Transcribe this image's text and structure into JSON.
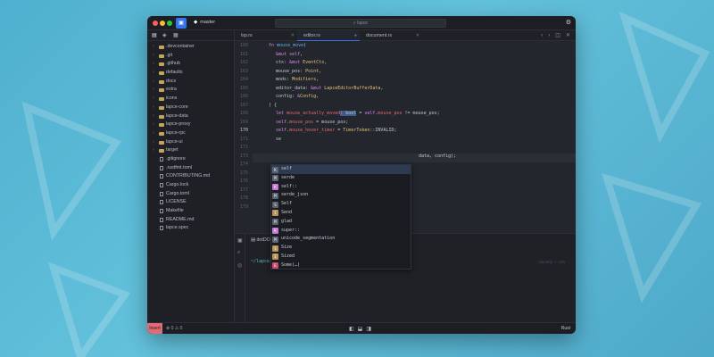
{
  "titlebar": {
    "branch": "master",
    "search_text": "lapce"
  },
  "sidebar": {
    "tree": [
      {
        "label": ".devcontainer",
        "kind": "folder"
      },
      {
        "label": ".git",
        "kind": "folder"
      },
      {
        "label": ".github",
        "kind": "folder"
      },
      {
        "label": "defaults",
        "kind": "folder"
      },
      {
        "label": "docs",
        "kind": "folder"
      },
      {
        "label": "extra",
        "kind": "folder"
      },
      {
        "label": "icons",
        "kind": "folder"
      },
      {
        "label": "lapce-core",
        "kind": "folder"
      },
      {
        "label": "lapce-data",
        "kind": "folder"
      },
      {
        "label": "lapce-proxy",
        "kind": "folder"
      },
      {
        "label": "lapce-rpc",
        "kind": "folder"
      },
      {
        "label": "lapce-ui",
        "kind": "folder"
      },
      {
        "label": "target",
        "kind": "folder"
      },
      {
        "label": ".gitignore",
        "kind": "file"
      },
      {
        "label": ".rustfmt.toml",
        "kind": "file"
      },
      {
        "label": "CONTRIBUTING.md",
        "kind": "file"
      },
      {
        "label": "Cargo.lock",
        "kind": "file"
      },
      {
        "label": "Cargo.toml",
        "kind": "file"
      },
      {
        "label": "LICENSE",
        "kind": "file"
      },
      {
        "label": "Makefile",
        "kind": "file"
      },
      {
        "label": "README.md",
        "kind": "file"
      },
      {
        "label": "lapce.spec",
        "kind": "file"
      }
    ]
  },
  "tabs": [
    {
      "label": "lsp.rs"
    },
    {
      "label": "editor.rs"
    },
    {
      "label": "document.rs"
    }
  ],
  "editor": {
    "line_numbers": [
      "160",
      "161",
      "162",
      "163",
      "164",
      "165",
      "166",
      "167",
      "168",
      "169",
      "170",
      "171",
      "172",
      "173",
      "174",
      "175",
      "176",
      "177",
      "178",
      "179"
    ]
  },
  "autocomplete": {
    "items": [
      {
        "label": "self",
        "icon": "K",
        "color": "#5c6370"
      },
      {
        "label": "serde",
        "icon": "M",
        "color": "#5c6370"
      },
      {
        "label": "self::",
        "icon": "K",
        "color": "#c678dd"
      },
      {
        "label": "serde_json",
        "icon": "M",
        "color": "#5c6370"
      },
      {
        "label": "Self",
        "icon": "S",
        "color": "#5c6370"
      },
      {
        "label": "Send",
        "icon": "I",
        "color": "#b8945a"
      },
      {
        "label": "glad",
        "icon": "M",
        "color": "#5c6370"
      },
      {
        "label": "super::",
        "icon": "K",
        "color": "#c678dd"
      },
      {
        "label": "unicode_segmentation",
        "icon": "M",
        "color": "#5c6370"
      },
      {
        "label": "Size",
        "icon": "S",
        "color": "#b8945a"
      },
      {
        "label": "Sized",
        "icon": "I",
        "color": "#b8945a"
      },
      {
        "label": "Some(…)",
        "icon": "E",
        "color": "#c84b73"
      }
    ]
  },
  "panel": {
    "terminal_title": "dotDO",
    "prompt": "~/lapce",
    "hint": "Alacritty — zsh"
  },
  "status": {
    "mode": "Insert",
    "errors": "0",
    "warnings": "0",
    "language": "Rust"
  },
  "colors": {
    "accent": "#3574f0",
    "mode_bg": "#e06c75"
  }
}
